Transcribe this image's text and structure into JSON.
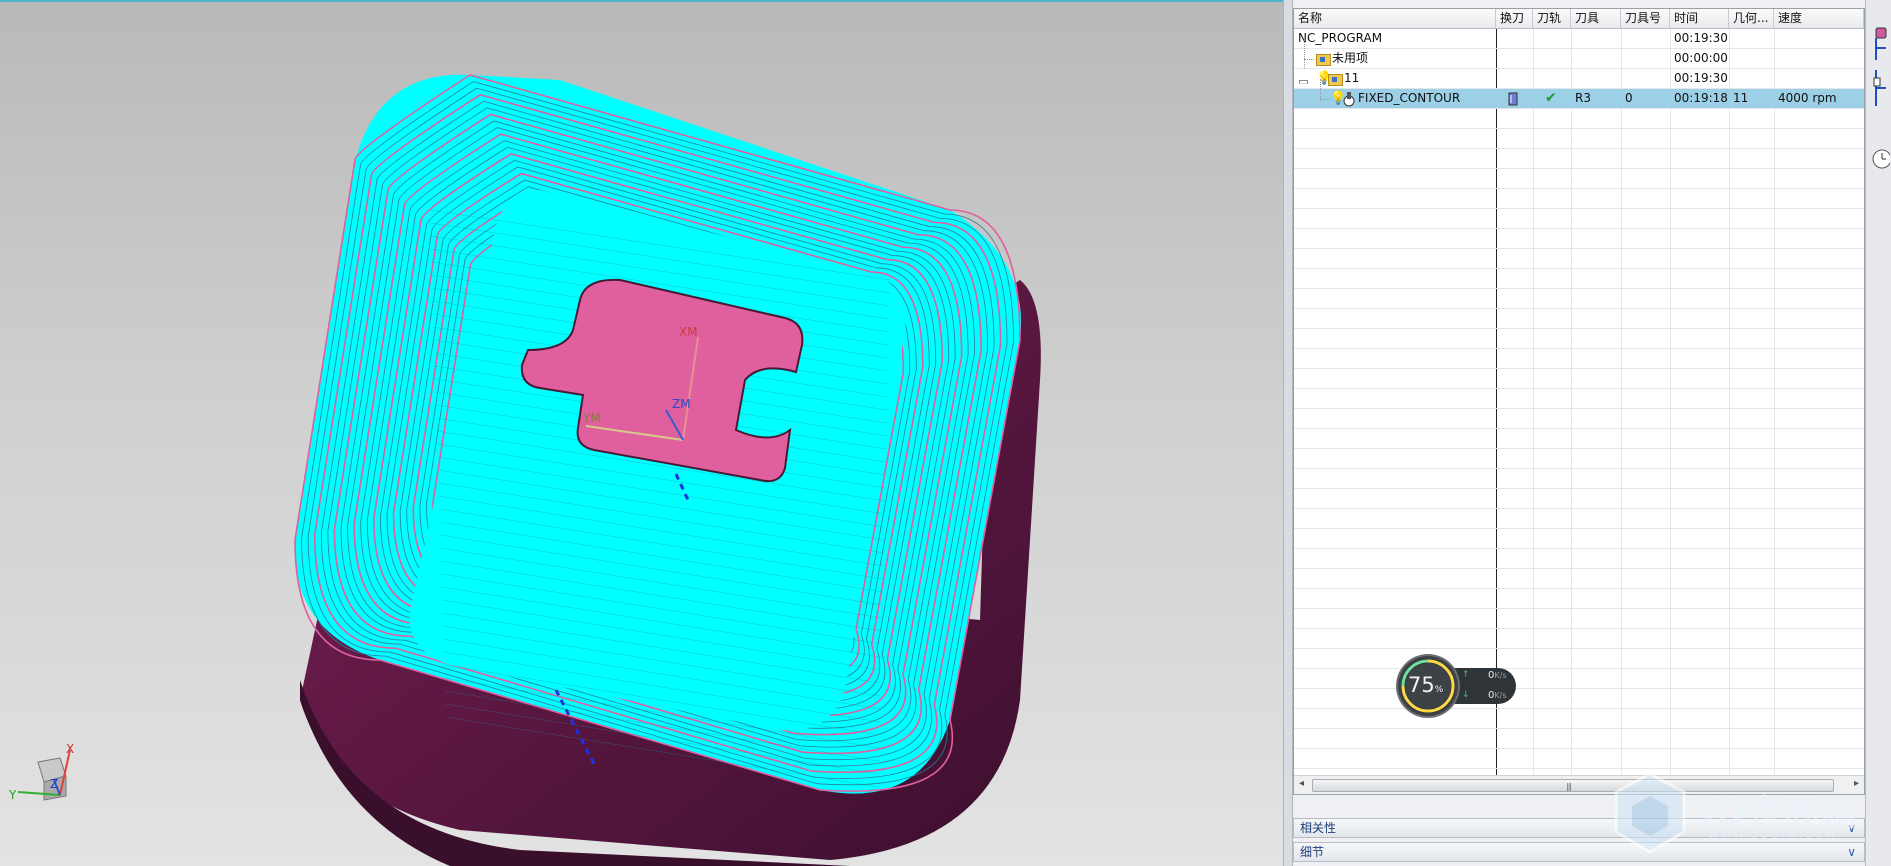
{
  "navigator": {
    "columns": [
      "名称",
      "换刀",
      "刀轨",
      "刀具",
      "刀具号",
      "时间",
      "几何...",
      "速度"
    ],
    "rows": [
      {
        "name": "NC_PROGRAM",
        "tool_change": "",
        "path": "",
        "tool": "",
        "tool_no": "",
        "time": "00:19:30",
        "geometry": "",
        "speed": "",
        "level": 0
      },
      {
        "name": "未用项",
        "tool_change": "",
        "path": "",
        "tool": "",
        "tool_no": "",
        "time": "00:00:00",
        "geometry": "",
        "speed": "",
        "level": 1
      },
      {
        "name": "11",
        "tool_change": "",
        "path": "",
        "tool": "",
        "tool_no": "",
        "time": "00:19:30",
        "geometry": "",
        "speed": "",
        "level": 1
      },
      {
        "name": "FIXED_CONTOUR",
        "tool_change": "tool-change-icon",
        "path": "check-icon",
        "tool": "R3",
        "tool_no": "0",
        "time": "00:19:18",
        "geometry": "11",
        "speed": "4000 rpm",
        "level": 2,
        "selected": true
      }
    ],
    "sections": [
      {
        "label": "相关性"
      },
      {
        "label": "细节"
      }
    ]
  },
  "viewport": {
    "wcs_labels": {
      "xm": "XM",
      "ym": "YM",
      "zm": "ZM"
    },
    "triad_labels": {
      "x": "X",
      "y": "Y",
      "z": "Z"
    },
    "colors": {
      "toolpath": "#00ffff",
      "part_face": "#e0609f",
      "part_wall": "#6e1a4e",
      "background_top": "#b9b9b9",
      "background_bottom": "#e3e3e3"
    }
  },
  "net_widget": {
    "percent": "75",
    "percent_unit": "%",
    "upload": "0",
    "download": "0",
    "unit": "K/s"
  },
  "watermark": {
    "text": "3D世界网",
    "sub": "WWW.3DSJW.COM"
  }
}
